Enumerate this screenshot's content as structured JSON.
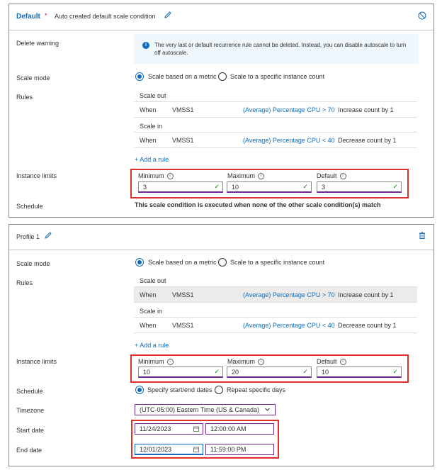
{
  "default_card": {
    "title": "Default",
    "required_mark": "*",
    "subtitle": "Auto created default scale condition",
    "delete_warning_label": "Delete warning",
    "warning_text": "The very last or default recurrence rule cannot be deleted. Instead, you can disable autoscale to turn off autoscale.",
    "scale_mode_label": "Scale mode",
    "scale_option_metric": "Scale based on a metric",
    "scale_option_count": "Scale to a specific instance count",
    "rules_label": "Rules",
    "scale_out_header": "Scale out",
    "scale_in_header": "Scale in",
    "rule_out": {
      "when": "When",
      "resource": "VMSS1",
      "metric": "(Average) Percentage CPU > 70",
      "action": "Increase count by 1"
    },
    "rule_in": {
      "when": "When",
      "resource": "VMSS1",
      "metric": "(Average) Percentage CPU < 40",
      "action": "Decrease count by 1"
    },
    "add_rule": "+ Add a rule",
    "instance_limits_label": "Instance limits",
    "minimum_label": "Minimum",
    "maximum_label": "Maximum",
    "default_label": "Default",
    "minimum_value": "3",
    "maximum_value": "10",
    "default_value": "3",
    "schedule_label": "Schedule",
    "schedule_text": "This scale condition is executed when none of the other scale condition(s) match"
  },
  "profile_card": {
    "title": "Profile 1",
    "scale_mode_label": "Scale mode",
    "scale_option_metric": "Scale based on a metric",
    "scale_option_count": "Scale to a specific instance count",
    "rules_label": "Rules",
    "scale_out_header": "Scale out",
    "scale_in_header": "Scale in",
    "rule_out": {
      "when": "When",
      "resource": "VMSS1",
      "metric": "(Average) Percentage CPU > 70",
      "action": "Increase count by 1"
    },
    "rule_in": {
      "when": "When",
      "resource": "VMSS1",
      "metric": "(Average) Percentage CPU < 40",
      "action": "Decrease count by 1"
    },
    "add_rule": "+ Add a rule",
    "instance_limits_label": "Instance limits",
    "minimum_label": "Minimum",
    "maximum_label": "Maximum",
    "default_label": "Default",
    "minimum_value": "10",
    "maximum_value": "20",
    "default_value": "10",
    "schedule_label": "Schedule",
    "schedule_option_dates": "Specify start/end dates",
    "schedule_option_repeat": "Repeat specific days",
    "timezone_label": "Timezone",
    "timezone_value": "(UTC-05:00) Eastern Time (US & Canada)",
    "start_date_label": "Start date",
    "start_date": "11/24/2023",
    "start_time": "12:00:00 AM",
    "end_date_label": "End date",
    "end_date": "12/01/2023",
    "end_time": "11:59:00 PM"
  },
  "colors": {
    "accent": "#0f6cbd",
    "highlight_box": "#e0312e",
    "success": "#107c10"
  }
}
